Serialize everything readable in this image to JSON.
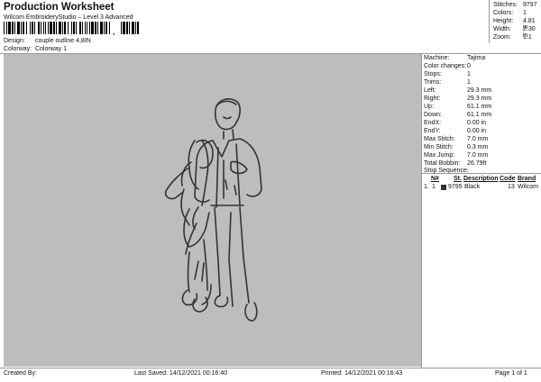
{
  "header": {
    "title": "Production Worksheet",
    "subtitle": "Wilcom EmbroideryStudio – Level 3 Advanced",
    "barcode_text": ","
  },
  "design_info": [
    {
      "label": "Design:",
      "value": "couple outline 4,8IN"
    },
    {
      "label": "Colorway:",
      "value": "Colorway 1"
    }
  ],
  "summary_stats": [
    {
      "label": "Stitches:",
      "value": "9797"
    },
    {
      "label": "Colors:",
      "value": "1"
    },
    {
      "label": "Height:",
      "value": "4.81 in"
    },
    {
      "label": "Width:",
      "value": "2.30 in"
    },
    {
      "label": "Zoom:",
      "value": "1:1"
    }
  ],
  "machine_details": [
    {
      "label": "Machine:",
      "value": "Tajima"
    },
    {
      "label": "Color changes:",
      "value": "0"
    },
    {
      "label": "Stops:",
      "value": "1"
    },
    {
      "label": "Trims:",
      "value": "1"
    },
    {
      "label": "Left:",
      "value": "29.3 mm"
    },
    {
      "label": "Right:",
      "value": "29.3 mm"
    },
    {
      "label": "Up:",
      "value": "61.1 mm"
    },
    {
      "label": "Down:",
      "value": "61.1 mm"
    },
    {
      "label": "EndX:",
      "value": "0.00 in"
    },
    {
      "label": "EndY:",
      "value": "0.00 in"
    },
    {
      "label": "Max Stitch:",
      "value": "7.0 mm"
    },
    {
      "label": "Min Stitch:",
      "value": "0.3 mm"
    },
    {
      "label": "Max Jump:",
      "value": "7.0 mm"
    },
    {
      "label": "Total Bobbin:",
      "value": "26.79ft"
    }
  ],
  "stop_sequence": {
    "title": "Stop Sequence:",
    "headers": {
      "number": "N#",
      "stitches": "St.",
      "description": "Description",
      "code": "Code",
      "brand": "Brand"
    },
    "rows": [
      {
        "index": "1.",
        "number": "1",
        "stitches": "9795",
        "description": "Black",
        "code": "13",
        "brand": "Wilcom",
        "color": "#333333"
      }
    ]
  },
  "footer": {
    "created_by": "Created By:",
    "last_saved": "Last Saved: 14/12/2021 00:16:40",
    "printed": "Printed: 14/12/2021 00:16:43",
    "page": "Page 1 of 1"
  },
  "colors": {
    "canvas_bg": "#bdbdbd",
    "thread": "#333333"
  }
}
